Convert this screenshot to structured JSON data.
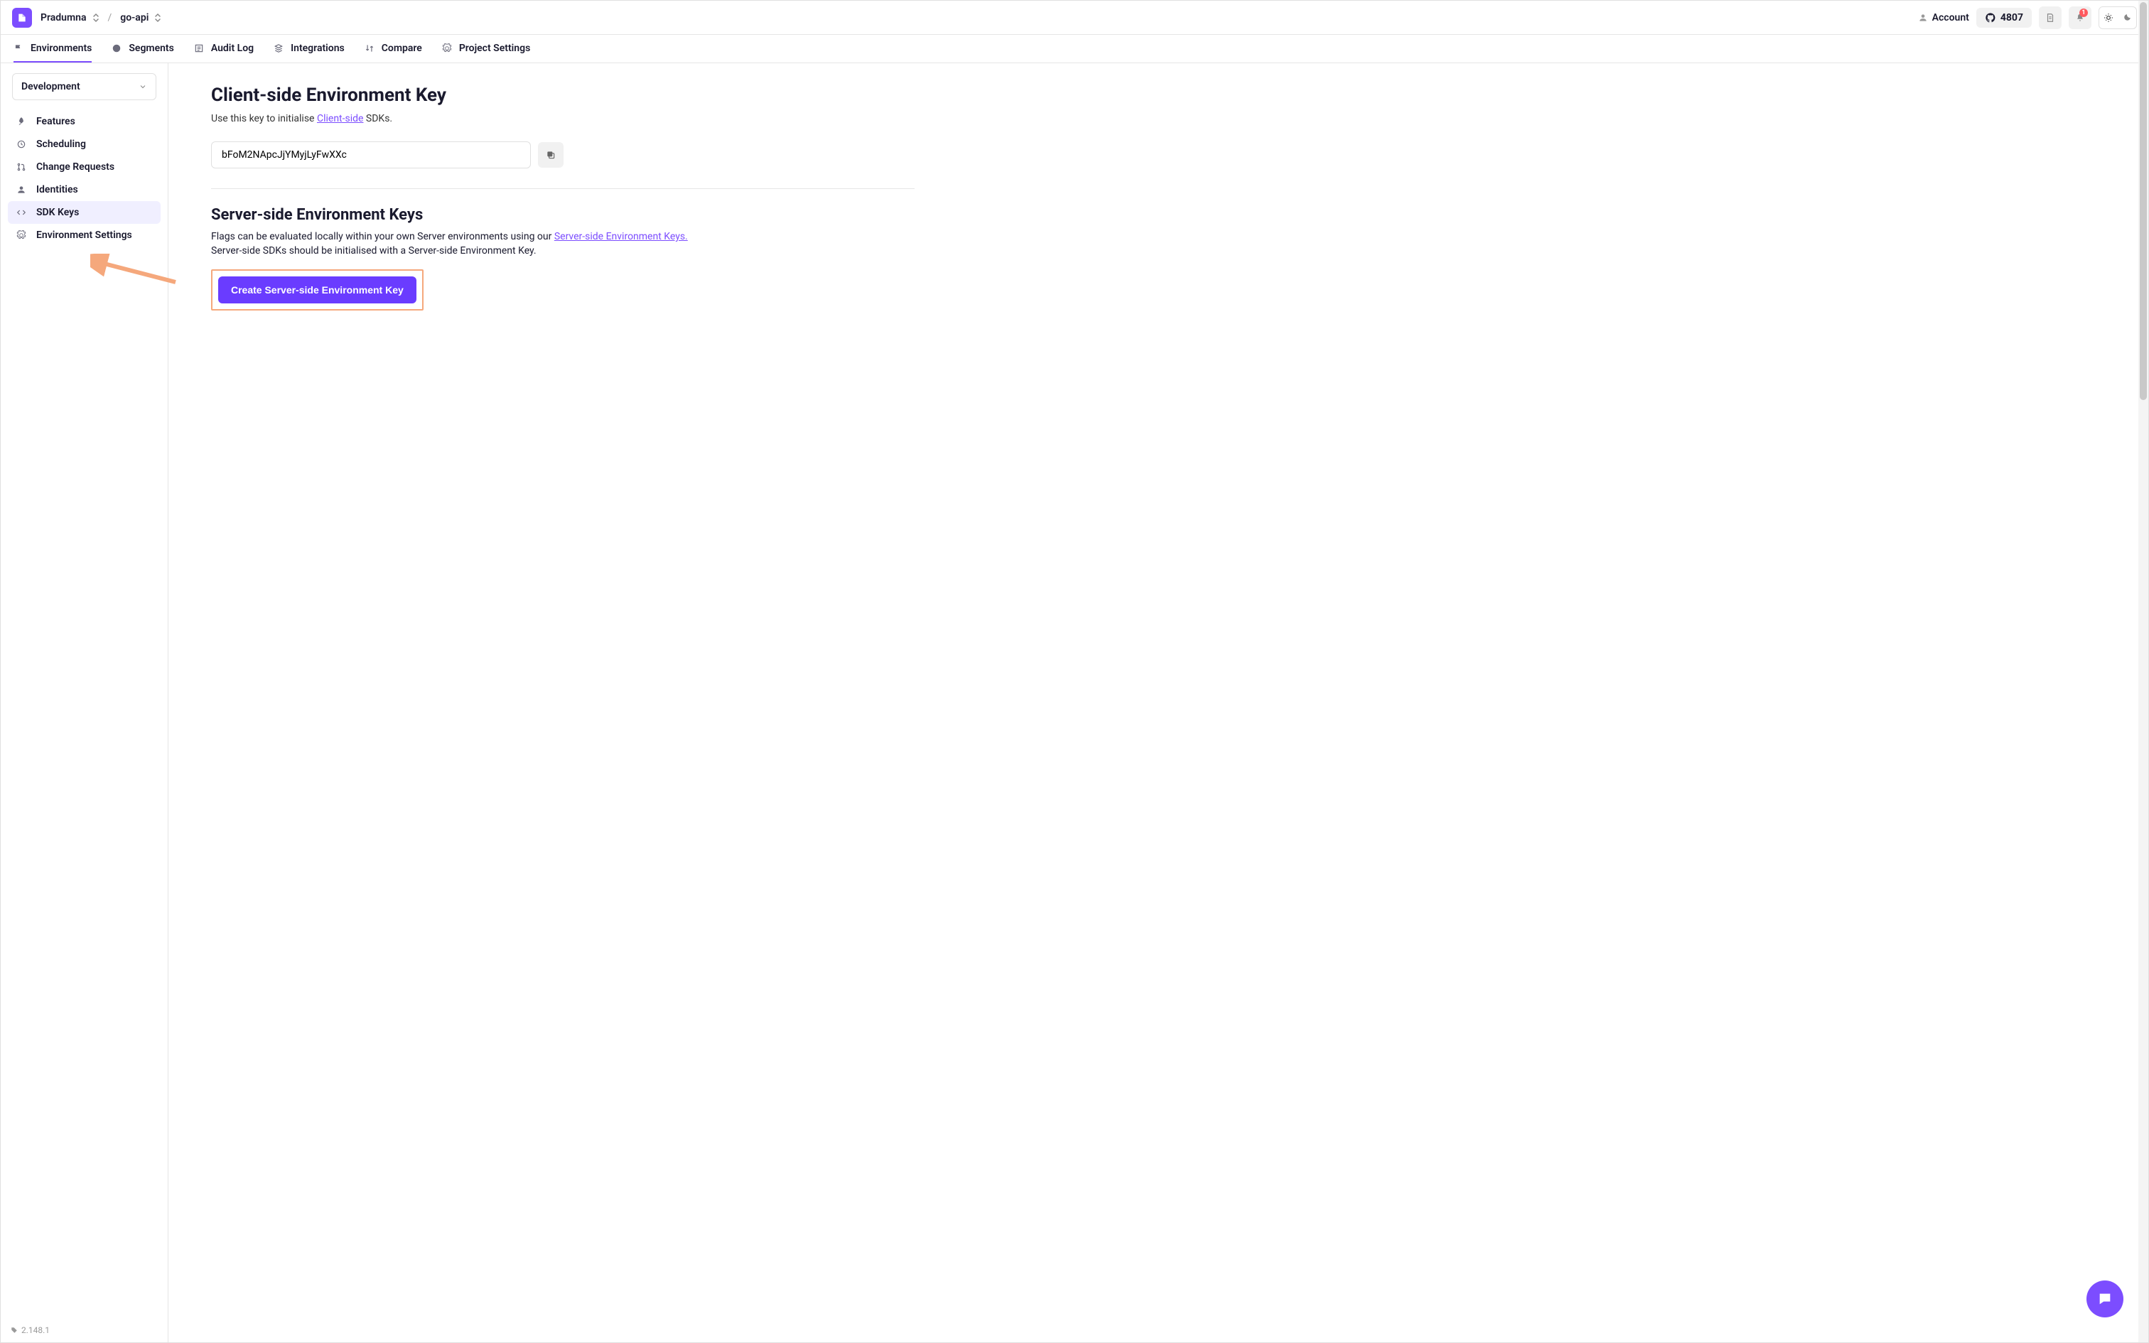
{
  "header": {
    "org": "Pradumna",
    "project": "go-api",
    "account_label": "Account",
    "github_count": "4807",
    "notification_count": "1"
  },
  "topnav": [
    {
      "label": "Environments",
      "icon": "flag-icon",
      "active": true
    },
    {
      "label": "Segments",
      "icon": "pie-icon",
      "active": false
    },
    {
      "label": "Audit Log",
      "icon": "list-icon",
      "active": false
    },
    {
      "label": "Integrations",
      "icon": "stack-icon",
      "active": false
    },
    {
      "label": "Compare",
      "icon": "swap-icon",
      "active": false
    },
    {
      "label": "Project Settings",
      "icon": "gear-icon",
      "active": false
    }
  ],
  "sidebar": {
    "env_selected": "Development",
    "items": [
      {
        "label": "Features",
        "icon": "rocket-icon",
        "active": false
      },
      {
        "label": "Scheduling",
        "icon": "clock-icon",
        "active": false
      },
      {
        "label": "Change Requests",
        "icon": "pr-icon",
        "active": false
      },
      {
        "label": "Identities",
        "icon": "user-icon",
        "active": false
      },
      {
        "label": "SDK Keys",
        "icon": "code-icon",
        "active": true
      },
      {
        "label": "Environment Settings",
        "icon": "gear-icon",
        "active": false
      }
    ]
  },
  "content": {
    "client_title": "Client-side Environment Key",
    "client_desc_prefix": "Use this key to initialise ",
    "client_desc_link": "Client-side",
    "client_desc_suffix": " SDKs.",
    "client_key_value": "bFoM2NApcJjYMyjLyFwXXc",
    "server_title": "Server-side Environment Keys",
    "server_desc_prefix": "Flags can be evaluated locally within your own Server environments using our ",
    "server_desc_link": "Server-side Environment Keys.",
    "server_desc2": "Server-side SDKs should be initialised with a Server-side Environment Key.",
    "create_button": "Create Server-side Environment Key"
  },
  "footer": {
    "version": "2.148.1"
  }
}
